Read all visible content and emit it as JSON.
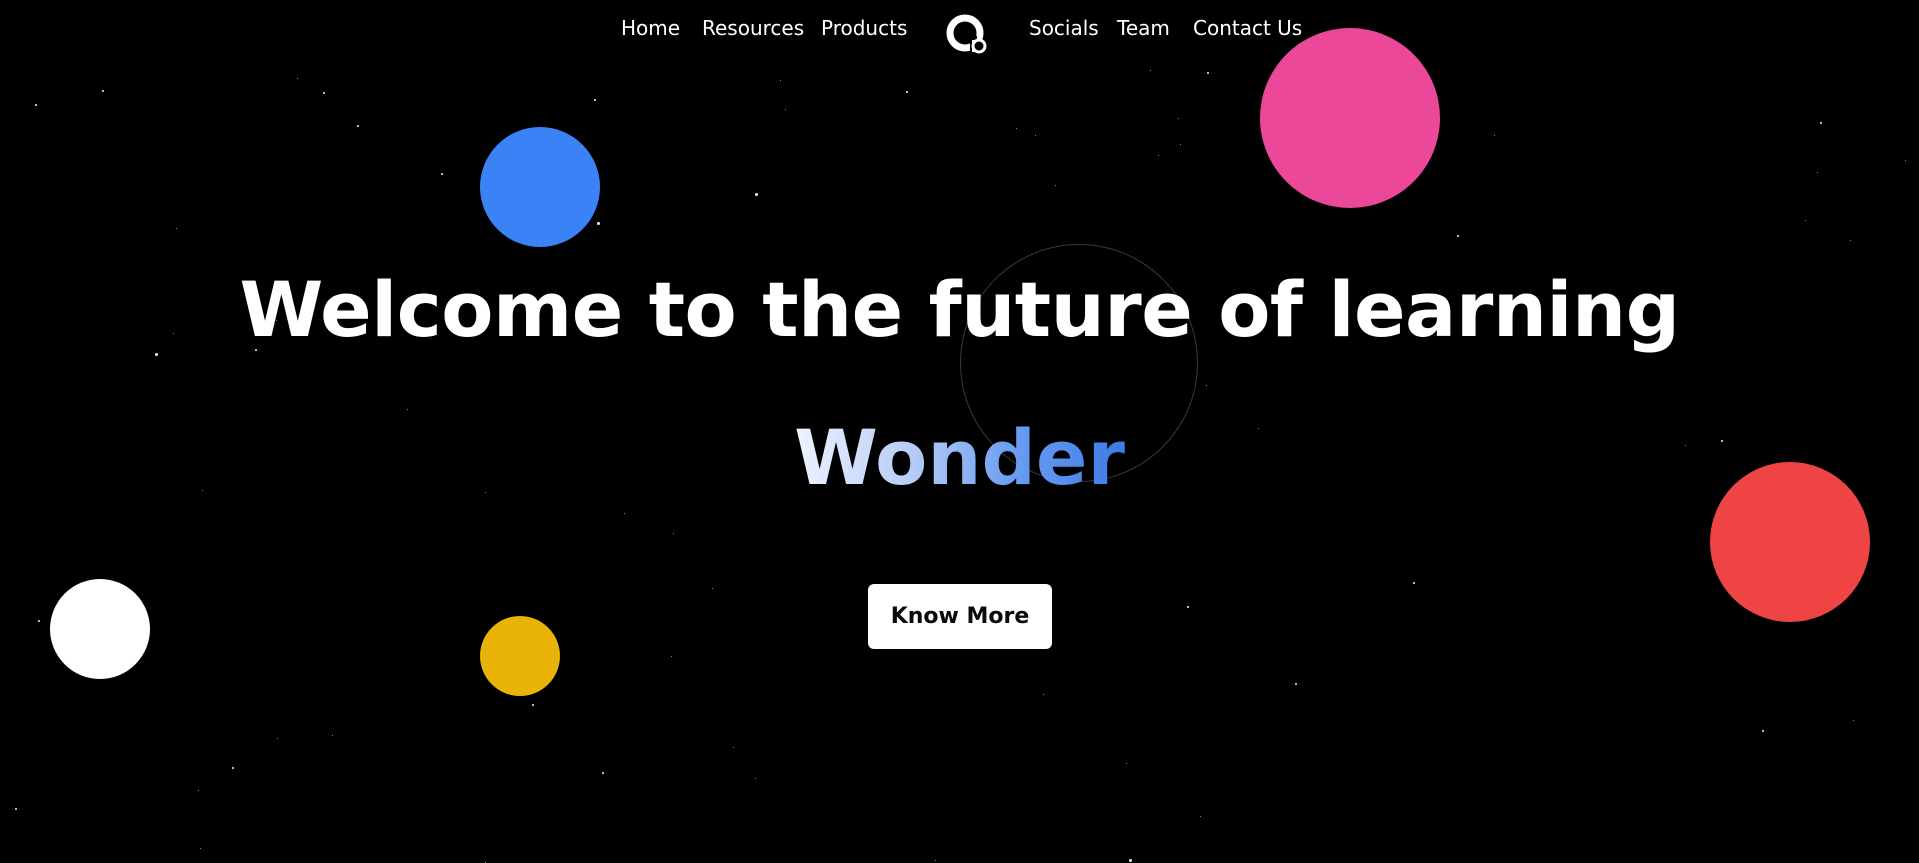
{
  "nav": {
    "left_links": [
      {
        "label": "Home"
      },
      {
        "label": "Resources"
      },
      {
        "label": "Products"
      }
    ],
    "right_links": [
      {
        "label": "Socials"
      },
      {
        "label": "Team"
      },
      {
        "label": "Contact Us"
      }
    ],
    "logo_icon": "brand-logo-icon"
  },
  "hero": {
    "title": "Welcome to the future of learning",
    "highlight_word": "Wonder",
    "cta_label": "Know More"
  },
  "colors": {
    "background": "#000000",
    "planet_blue": "#3b82f6",
    "planet_pink": "#ec4899",
    "planet_red": "#ef4444",
    "planet_yellow": "#eab308",
    "planet_white": "#ffffff",
    "gradient_start": "#eef3ff",
    "gradient_end": "#3b7be8"
  }
}
